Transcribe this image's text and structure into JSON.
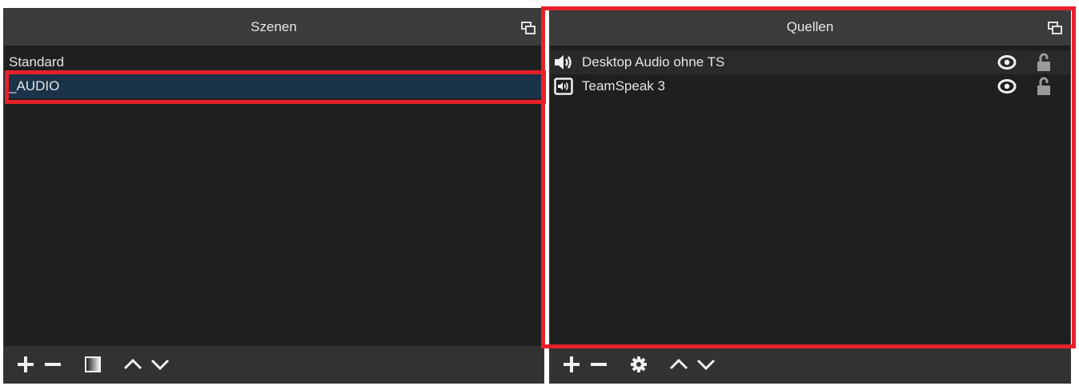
{
  "scenes": {
    "title": "Szenen",
    "items": [
      {
        "label": "Standard"
      },
      {
        "label": "_AUDIO"
      }
    ]
  },
  "sources": {
    "title": "Quellen",
    "items": [
      {
        "label": "Desktop Audio ohne TS",
        "icon": "speaker-icon"
      },
      {
        "label": "TeamSpeak 3",
        "icon": "audio-capture-icon"
      }
    ]
  },
  "colors": {
    "highlight": "#e8202a",
    "selected": "#1b3349",
    "header": "#3b3b3b",
    "panel": "#1f1f1f"
  }
}
